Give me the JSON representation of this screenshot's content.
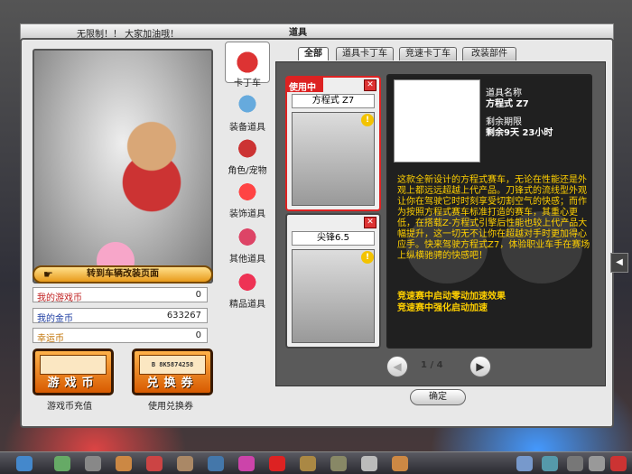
{
  "header": {
    "notice": "无限制！！ 大家加油哦！",
    "title": "道具"
  },
  "left": {
    "goto_button": "转到车辆改装页面",
    "currencies": [
      {
        "label": "我的游戏币",
        "value": "0"
      },
      {
        "label": "我的金币",
        "value": "633267"
      },
      {
        "label": "幸运币",
        "value": "0"
      }
    ],
    "game_coin_button": "游戏币",
    "game_coin_caption": "游戏币充值",
    "voucher_button": "兑换券",
    "voucher_code": "B 8K5874258",
    "voucher_caption": "使用兑换券"
  },
  "categories": [
    {
      "label": "卡丁车",
      "icon": "kart-icon",
      "active": true
    },
    {
      "label": "装备道具",
      "icon": "goggles-icon"
    },
    {
      "label": "角色/宠物",
      "icon": "character-icon"
    },
    {
      "label": "装饰道具",
      "icon": "flame-icon"
    },
    {
      "label": "其他道具",
      "icon": "gift-box-icon"
    },
    {
      "label": "精品道具",
      "icon": "gem-icon"
    }
  ],
  "tabs": [
    {
      "label": "全部",
      "active": true
    },
    {
      "label": "道具卡丁车"
    },
    {
      "label": "竞速卡丁车"
    },
    {
      "label": "改装部件"
    }
  ],
  "cards": [
    {
      "status": "使用中",
      "name": "方程式 Z7",
      "close": "✕",
      "info": "!"
    },
    {
      "status": "",
      "name": "尖锋6.5",
      "close": "✕",
      "info": "!"
    }
  ],
  "detail": {
    "name_label": "道具名称",
    "name_value": "方程式 Z7",
    "remaining_label": "剩余期限",
    "remaining_value": "剩余9天 23小时",
    "description": "这款全新设计的方程式赛车，无论在性能还是外观上都远远超越上代产品。刀锋式的流线型外观让你在驾驶它时时刻享受切割空气的快感；而作为按照方程式赛车标准打造的赛车，其重心更低，在搭载Z-方程式引擎后性能也较上代产品大幅提升，这一切无不让你在超越对手时更加得心应手。快来驾驶方程式Z7，体验职业车手在赛场上纵横驰骋的快感吧！",
    "effects": [
      "竞速赛中启动零动加速效果",
      "竞速赛中强化启动加速"
    ]
  },
  "pager": {
    "current": "1",
    "sep": "/",
    "total": "4",
    "prev": "◀",
    "next": "▶"
  },
  "ok_button": "确定",
  "side_arrow": "◀",
  "colors": {
    "accent": "#e89a1a",
    "active_card": "#d22222",
    "desc_text": "#ffd000"
  }
}
